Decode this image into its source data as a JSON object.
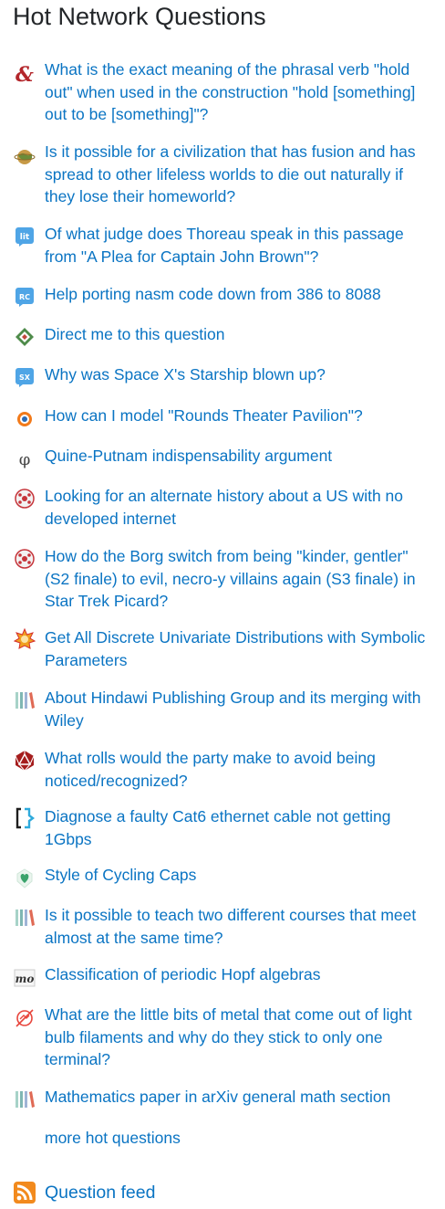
{
  "section": {
    "title": "Hot Network Questions",
    "more_label": "more hot questions",
    "feed_label": "Question feed"
  },
  "questions": [
    {
      "icon": "english-icon",
      "title": "What is the exact meaning of the phrasal verb \"hold out\" when used in the construction \"hold [something] out to be [something]\"?"
    },
    {
      "icon": "worldbuilding-icon",
      "title": "Is it possible for a civilization that has fusion and has spread to other lifeless worlds to die out naturally if they lose their homeworld?"
    },
    {
      "icon": "literature-icon",
      "title": "Of what judge does Thoreau speak in this passage from \"A Plea for Captain John Brown\"?"
    },
    {
      "icon": "retrocomputing-icon",
      "title": "Help porting nasm code down from 386 to 8088"
    },
    {
      "icon": "puzzling-icon",
      "title": "Direct me to this question"
    },
    {
      "icon": "space-exploration-icon",
      "title": "Why was Space X's Starship blown up?"
    },
    {
      "icon": "blender-icon",
      "title": "How can I model \"Rounds Theater Pavilion\"?"
    },
    {
      "icon": "philosophy-icon",
      "title": "Quine-Putnam indispensability argument"
    },
    {
      "icon": "scifi-icon",
      "title": "Looking for an alternate history about a US with no developed internet"
    },
    {
      "icon": "scifi-icon",
      "title": "How do the Borg switch from being \"kinder, gentler\" (S2 finale) to evil, necro-y villains again (S3 finale) in Star Trek Picard?"
    },
    {
      "icon": "mathematica-icon",
      "title": "Get All Discrete Univariate Distributions with Symbolic Parameters"
    },
    {
      "icon": "academia-icon",
      "title": "About Hindawi Publishing Group and its merging with Wiley"
    },
    {
      "icon": "rpg-icon",
      "title": "What rolls would the party make to avoid being noticed/recognized?"
    },
    {
      "icon": "superuser-icon",
      "title": "Diagnose a faulty Cat6 ethernet cable not getting 1Gbps"
    },
    {
      "icon": "bicycles-icon",
      "title": "Style of Cycling Caps"
    },
    {
      "icon": "academia-icon",
      "title": "Is it possible to teach two different courses that meet almost at the same time?"
    },
    {
      "icon": "mathoverflow-icon",
      "title": "Classification of periodic Hopf algebras"
    },
    {
      "icon": "electronics-icon",
      "title": "What are the little bits of metal that come out of light bulb filaments and why do they stick to only one terminal?"
    },
    {
      "icon": "academia-icon",
      "title": "Mathematics paper in arXiv general math section"
    }
  ],
  "icons": {
    "english-icon": {
      "color": "#b3262b"
    },
    "worldbuilding-icon": {
      "color": "#b58a3e"
    },
    "literature-icon": {
      "color": "#4fa5e6",
      "text": "lit"
    },
    "retrocomputing-icon": {
      "color": "#4fa5e6",
      "text": "RC"
    },
    "puzzling-icon": {
      "color": "#4e8b4a"
    },
    "space-exploration-icon": {
      "color": "#4fa5e6",
      "text": "SX"
    },
    "blender-icon": {
      "color": "#f27a1a"
    },
    "philosophy-icon": {
      "color": "#444444",
      "text": "φ"
    },
    "scifi-icon": {
      "color": "#c6343a"
    },
    "mathematica-icon": {
      "color": "#f0a020"
    },
    "academia-icon": {
      "color": "#7fb7b3"
    },
    "rpg-icon": {
      "color": "#a51d1d"
    },
    "superuser-icon": {
      "color": "#2eaadc"
    },
    "bicycles-icon": {
      "color": "#3aa36b"
    },
    "mathoverflow-icon": {
      "color": "#333333",
      "text": "mo"
    },
    "electronics-icon": {
      "color": "#e8453c"
    }
  },
  "rss-icon": {
    "color": "#f28a1d"
  }
}
